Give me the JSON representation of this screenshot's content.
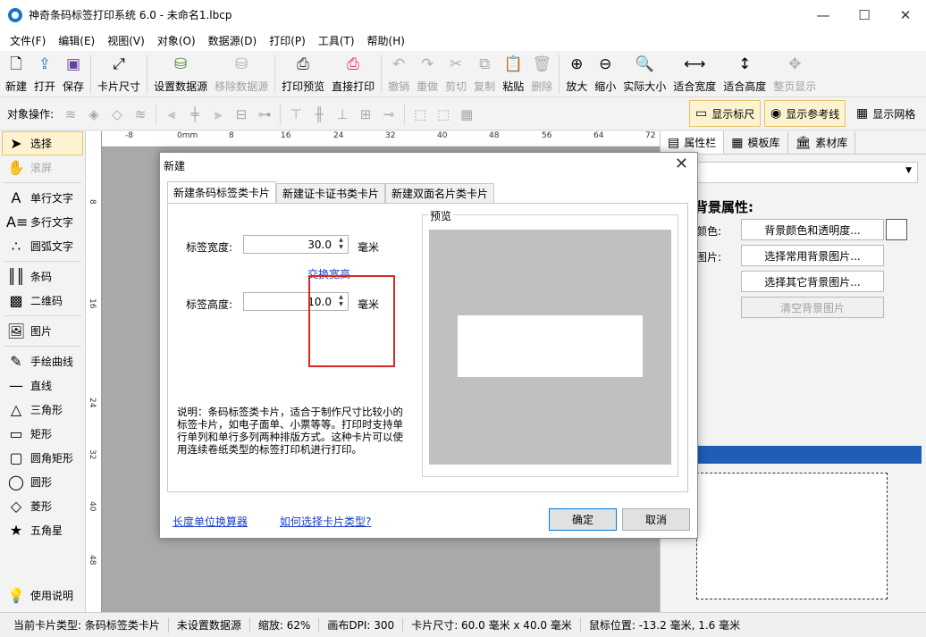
{
  "window": {
    "title": "神奇条码标签打印系统 6.0 - 未命名1.lbcp",
    "minimize": "—",
    "maximize": "☐",
    "close": "✕"
  },
  "menu": [
    "文件(F)",
    "编辑(E)",
    "视图(V)",
    "对象(O)",
    "数据源(D)",
    "打印(P)",
    "工具(T)",
    "帮助(H)"
  ],
  "toolbar": {
    "new": "新建",
    "open": "打开",
    "save": "保存",
    "card_size": "卡片尺寸",
    "set_datasource": "设置数据源",
    "remove_datasource": "移除数据源",
    "print_preview": "打印预览",
    "direct_print": "直接打印",
    "undo": "撤销",
    "redo": "重做",
    "cut": "剪切",
    "copy": "复制",
    "paste": "粘贴",
    "delete": "删除",
    "zoom_in": "放大",
    "zoom_out": "缩小",
    "actual_size": "实际大小",
    "fit_width": "适合宽度",
    "fit_height": "适合高度",
    "full_page": "整页显示"
  },
  "objbar": {
    "label": "对象操作:",
    "show_ruler": "显示标尺",
    "show_guides": "显示参考线",
    "show_grid": "显示网格"
  },
  "tools": {
    "select": "选择",
    "scroll": "滚屏",
    "single_text": "单行文字",
    "multi_text": "多行文字",
    "arc_text": "圆弧文字",
    "barcode": "条码",
    "qrcode": "二维码",
    "image": "图片",
    "freehand": "手绘曲线",
    "line": "直线",
    "triangle": "三角形",
    "rectangle": "矩形",
    "rounded_rect": "圆角矩形",
    "ellipse": "圆形",
    "diamond": "菱形",
    "star": "五角星",
    "help": "使用说明"
  },
  "ruler": {
    "top": [
      "-8",
      "0mm",
      "8",
      "16",
      "24",
      "32",
      "40",
      "48",
      "56",
      "64",
      "72"
    ],
    "left": [
      "8",
      "16",
      "24",
      "32",
      "40",
      "48"
    ]
  },
  "right_panel": {
    "tabs": [
      "属性栏",
      "模板库",
      "素材库"
    ],
    "heading": "背景属性:",
    "color_label": "颜色:",
    "image_label": "图片:",
    "btn_bg_color": "背景颜色和透明度...",
    "btn_common_bg": "选择常用背景图片...",
    "btn_other_bg": "选择其它背景图片...",
    "btn_clear_bg": "清空背景图片"
  },
  "statusbar": {
    "card_type": "当前卡片类型: 条码标签类卡片",
    "datasource": "未设置数据源",
    "zoom": "缩放: 62%",
    "dpi": "画布DPI: 300",
    "card_size": "卡片尺寸: 60.0 毫米 x 40.0 毫米",
    "mouse_pos": "鼠标位置: -13.2 毫米, 1.6 毫米"
  },
  "dialog": {
    "title": "新建",
    "close": "✕",
    "tabs": [
      "新建条码标签类卡片",
      "新建证卡证书类卡片",
      "新建双面名片类卡片"
    ],
    "width_label": "标签宽度:",
    "width_value": "30.0",
    "height_label": "标签高度:",
    "height_value": "10.0",
    "unit": "毫米",
    "swap_link": "交换宽高",
    "description": "说明：条码标签类卡片，适合于制作尺寸比较小的标签卡片，如电子面单、小票等等。打印时支持单行单列和单行多列两种排版方式。这种卡片可以使用连续卷纸类型的标签打印机进行打印。",
    "preview_label": "预览",
    "link_unit_calc": "长度单位换算器",
    "link_how_choose": "如何选择卡片类型?",
    "ok": "确定",
    "cancel": "取消"
  }
}
